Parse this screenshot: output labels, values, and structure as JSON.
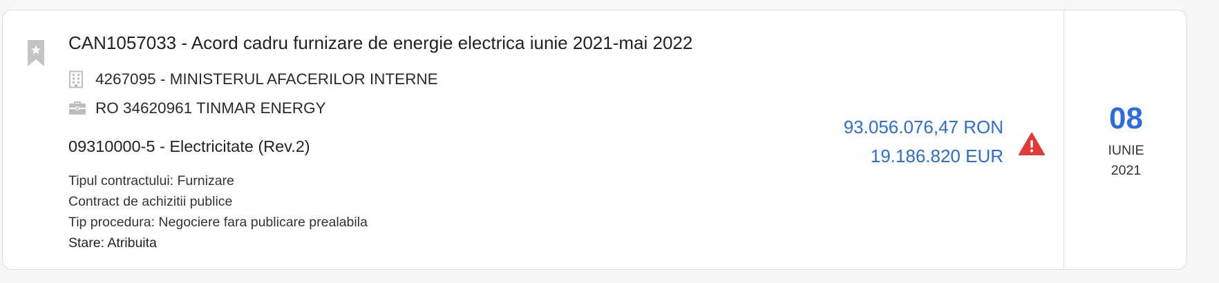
{
  "tender": {
    "title": "CAN1057033 - Acord cadru furnizare de energie electrica iunie 2021-mai 2022",
    "authority": "4267095 - MINISTERUL AFACERILOR INTERNE",
    "supplier": "RO 34620961 TINMAR ENERGY",
    "cpv": "09310000-5 - Electricitate (Rev.2)",
    "contract_type": "Tipul contractului: Furnizare",
    "contract_kind": "Contract de achizitii publice",
    "procedure": "Tip procedura: Negociere fara publicare prealabila",
    "status": "Stare: Atribuita"
  },
  "amounts": {
    "ron": "93.056.076,47 RON",
    "eur": "19.186.820 EUR"
  },
  "date": {
    "day": "08",
    "month": "IUNIE",
    "year": "2021"
  },
  "icons": {
    "bookmark": "bookmark-star-icon",
    "authority": "building-icon",
    "supplier": "briefcase-icon",
    "alert": "warning-triangle-icon"
  },
  "colors": {
    "accent": "#2b6ce0",
    "warning": "#e53935",
    "icon_gray": "#bdbdbd"
  }
}
